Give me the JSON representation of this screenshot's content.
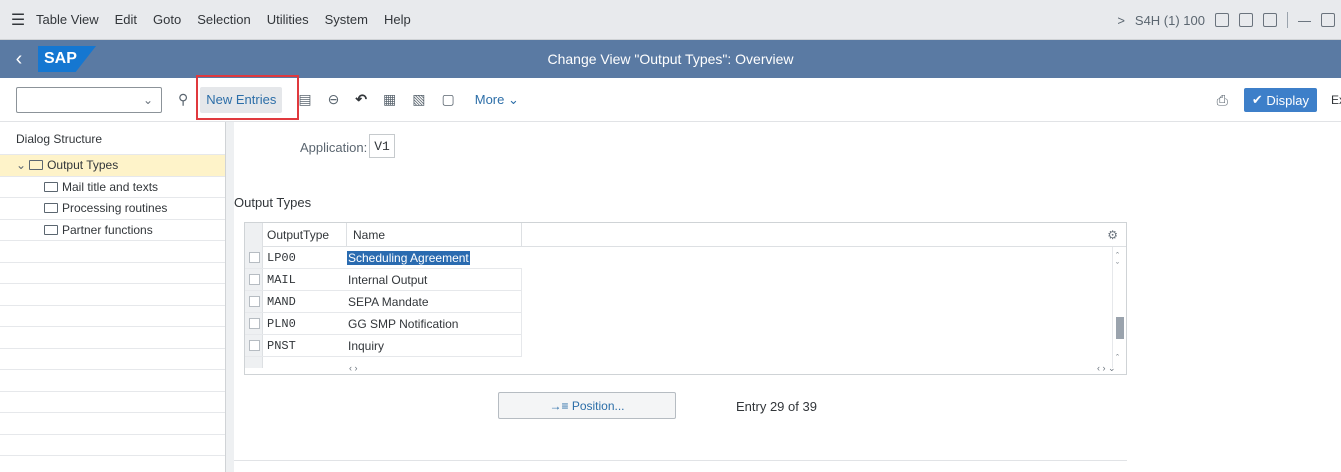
{
  "menu": {
    "items": [
      "Table View",
      "Edit",
      "Goto",
      "Selection",
      "Utilities",
      "System",
      "Help"
    ],
    "system_info": "S4H (1) 100",
    "chevron": ">"
  },
  "titlebar": {
    "logo": "SAP",
    "title": "Change View \"Output Types\": Overview"
  },
  "toolbar": {
    "command_field_value": "",
    "new_entries": "New Entries",
    "more": "More",
    "display": "Display",
    "exit": "Exit"
  },
  "dialog": {
    "heading": "Dialog Structure",
    "items": [
      {
        "label": "Output Types",
        "selected": true
      },
      {
        "label": "Mail title and texts"
      },
      {
        "label": "Processing routines"
      },
      {
        "label": "Partner functions"
      }
    ]
  },
  "main": {
    "application_label": "Application:",
    "application_value": "V1",
    "section_title": "Output Types",
    "columns": [
      "OutputType",
      "Name"
    ],
    "rows": [
      {
        "type": "LP00",
        "name": "Scheduling Agreement"
      },
      {
        "type": "MAIL",
        "name": "Internal Output"
      },
      {
        "type": "MAND",
        "name": "SEPA Mandate"
      },
      {
        "type": "PLN0",
        "name": "GG SMP Notification"
      },
      {
        "type": "PNST",
        "name": "Inquiry"
      }
    ],
    "position_button": "Position...",
    "entry_info": "Entry 29 of 39"
  },
  "colors": {
    "menubar_bg": "#e8eaed",
    "titlebar_bg": "#5a7aa3",
    "sap_logo": "#1577d1",
    "accent": "#2c6ea8",
    "highlight_box": "#e0393e",
    "selected_tree_row": "#fef3c9"
  }
}
